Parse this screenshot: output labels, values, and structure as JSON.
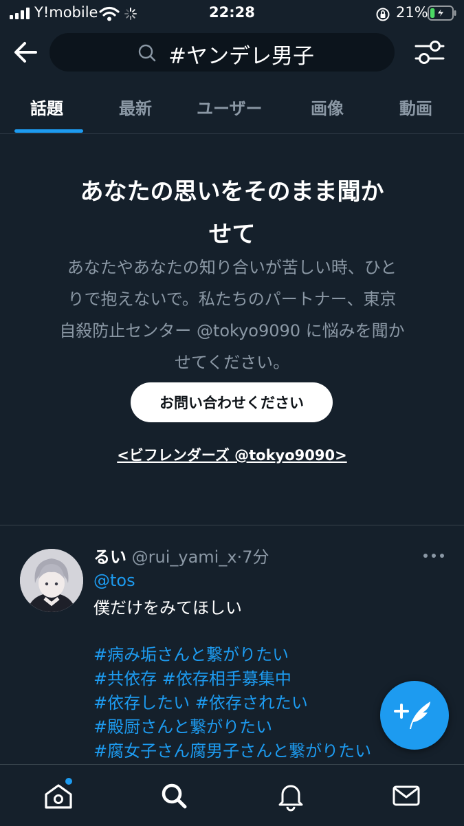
{
  "status_bar": {
    "carrier": "Y!mobile",
    "time": "22:28",
    "battery_percent": "21%",
    "battery_level": 0.21
  },
  "header": {
    "search_query": "#ヤンデレ男子"
  },
  "tabs": [
    {
      "label": "話題",
      "active": true
    },
    {
      "label": "最新",
      "active": false
    },
    {
      "label": "ユーザー",
      "active": false
    },
    {
      "label": "画像",
      "active": false
    },
    {
      "label": "動画",
      "active": false
    }
  ],
  "banner": {
    "title_line1": "あなたの思いをそのまま聞か",
    "title_line2": "せて",
    "body_lines": [
      "あなたやあなたの知り合いが苦しい時、ひと",
      "りで抱えないで。私たちのパートナー、東京",
      "自殺防止センター @tokyo9090 に悩みを聞か",
      "せてください。"
    ],
    "button_label": "お問い合わせください",
    "link_text": "<ビフレンダーズ @tokyo9090>"
  },
  "tweet": {
    "name": "るい",
    "handle": "@rui_yami_x",
    "separator": "·",
    "time": "7分",
    "mention": "@tos",
    "text": "僕だけをみてほしい",
    "hashtag_lines": [
      "#病み垢さんと繋がりたい",
      "#共依存 #依存相手募集中",
      "#依存したい #依存されたい",
      "#殿厨さんと繋がりたい",
      "#腐女子さん腐男子さんと繋がりたい"
    ]
  },
  "colors": {
    "background": "#15202b",
    "accent": "#1d9bf0",
    "secondary_text": "#8b98a5",
    "divider": "#38444d"
  },
  "icons": {
    "back": "arrow-left-icon",
    "search": "search-icon",
    "filter": "sliders-icon",
    "more": "more-horizontal-icon",
    "compose": "compose-tweet-icon",
    "nav": [
      "home-icon",
      "search-icon",
      "bell-icon",
      "mail-icon"
    ]
  },
  "bottom_nav": {
    "home_has_notification": true
  }
}
